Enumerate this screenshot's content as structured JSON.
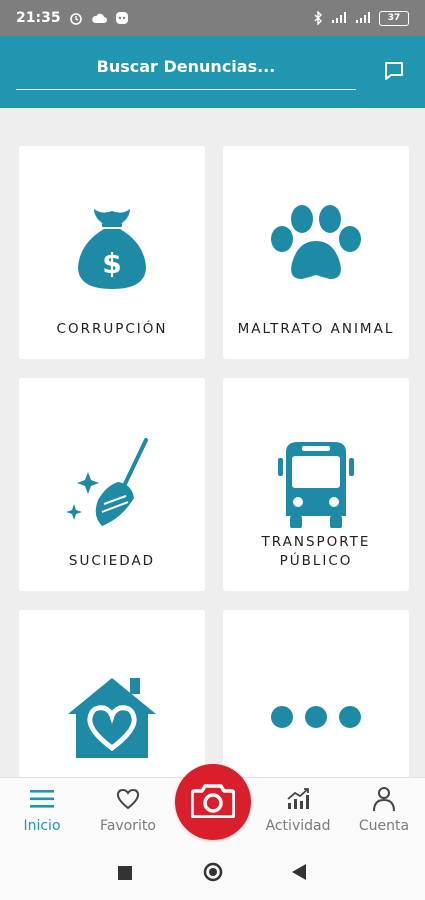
{
  "status_bar": {
    "time": "21:35",
    "battery": "37",
    "icons": [
      "alarm-icon",
      "cloud-icon",
      "app-notification-icon",
      "bluetooth-icon",
      "signal-icon",
      "battery-icon"
    ]
  },
  "header": {
    "search_placeholder": "Buscar Denuncias...",
    "chat_icon": "chat-icon"
  },
  "categories": [
    {
      "label": "CORRUPCIÓN",
      "icon": "money-bag-icon"
    },
    {
      "label": "MALTRATO ANIMAL",
      "icon": "paw-icon"
    },
    {
      "label": "SUCIEDAD",
      "icon": "broom-sparkle-icon"
    },
    {
      "label_line1": "TRANSPORTE",
      "label_line2": "PÚBLICO",
      "icon": "bus-icon"
    },
    {
      "label": "",
      "icon": "house-heart-icon"
    },
    {
      "label": "",
      "icon": "more-dots-icon"
    }
  ],
  "bottom_nav": {
    "items": [
      {
        "label": "Inicio",
        "icon": "menu-icon"
      },
      {
        "label": "Favorito",
        "icon": "heart-icon"
      },
      {
        "label": "",
        "icon": "camera-icon"
      },
      {
        "label": "Actividad",
        "icon": "chart-icon"
      },
      {
        "label": "Cuenta",
        "icon": "user-icon"
      }
    ],
    "active_index": 0
  },
  "colors": {
    "primary": "#2196b0",
    "icon": "#1f8aa5",
    "camera": "#d81f2b",
    "background": "#eeeeee"
  }
}
